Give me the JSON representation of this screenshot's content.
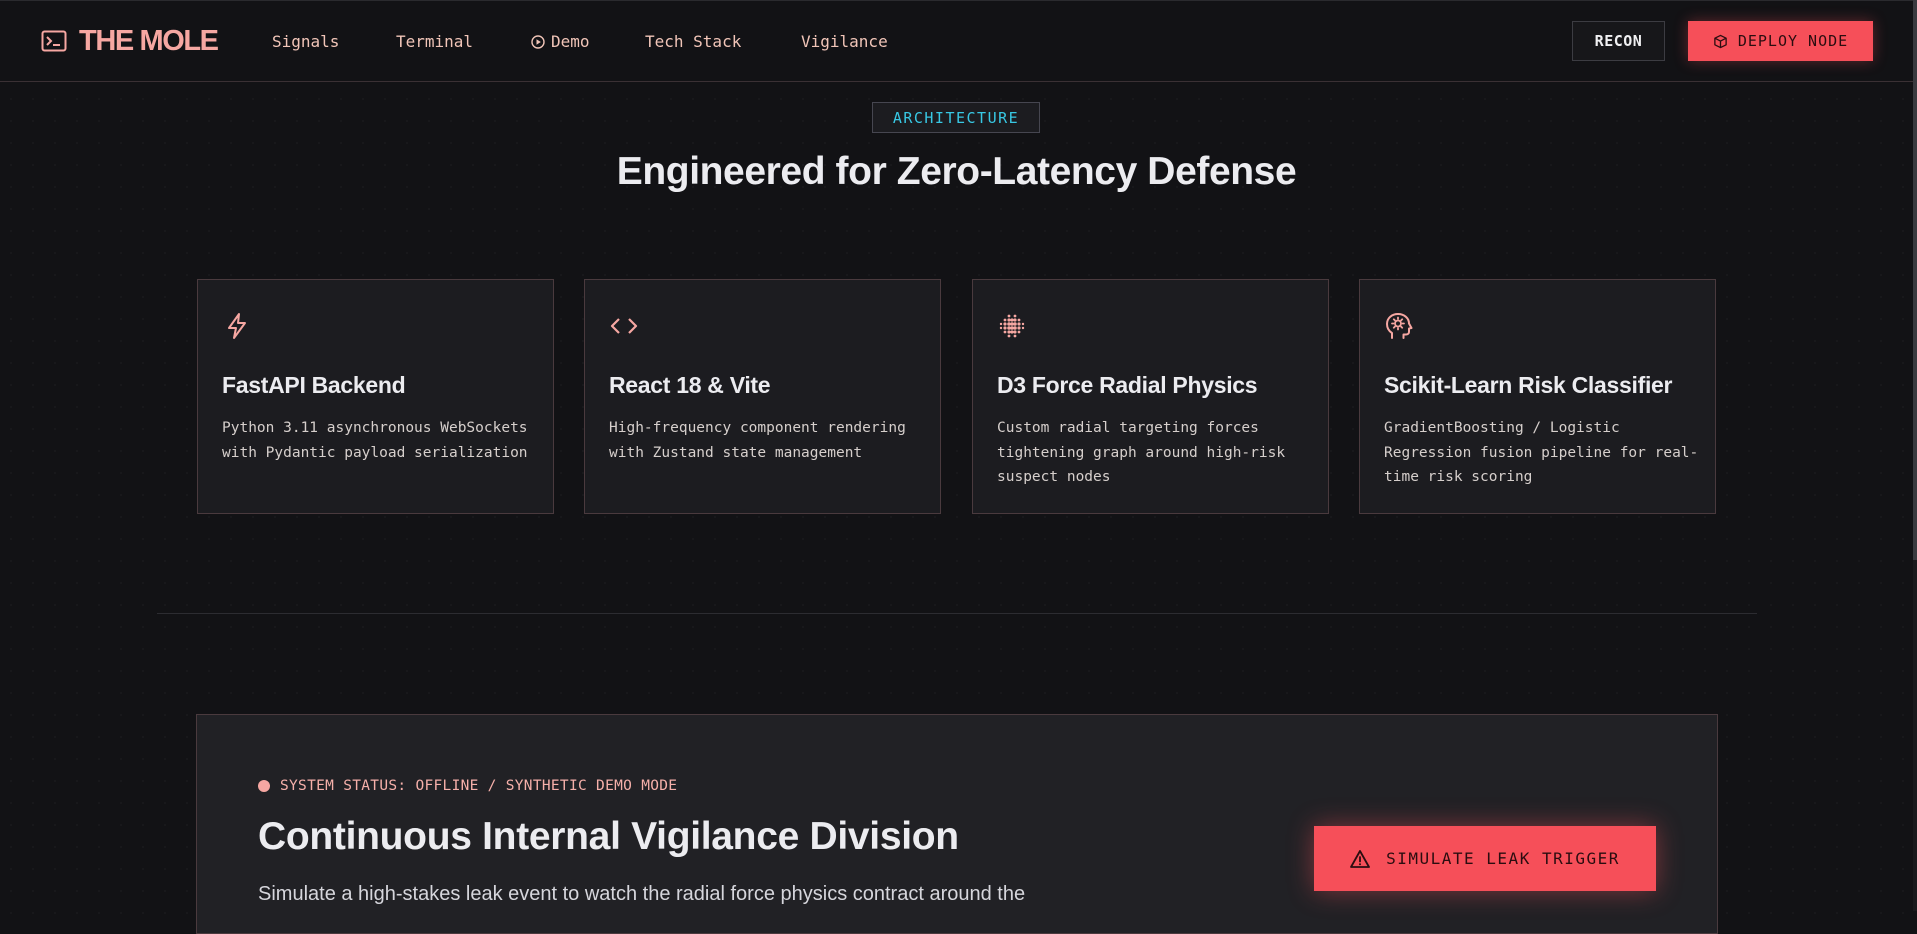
{
  "nav": {
    "brand": "THE MOLE",
    "links": [
      "Signals",
      "Terminal",
      "Demo",
      "Tech Stack",
      "Vigilance"
    ],
    "recon_label": "RECON",
    "deploy_label": "DEPLOY NODE"
  },
  "architecture": {
    "tag": "ARCHITECTURE",
    "heading": "Engineered for Zero-Latency Defense",
    "cards": [
      {
        "icon": "lightning-icon",
        "title": "FastAPI Backend",
        "description": "Python 3.11 asynchronous WebSockets with Pydantic payload serialization"
      },
      {
        "icon": "code-brackets-icon",
        "title": "React 18 & Vite",
        "description": "High-frequency component rendering with Zustand state management"
      },
      {
        "icon": "dot-grid-icon",
        "title": "D3 Force Radial Physics",
        "description": "Custom radial targeting forces tightening graph around high-risk suspect nodes"
      },
      {
        "icon": "brain-gear-icon",
        "title": "Scikit-Learn Risk Classifier",
        "description": "GradientBoosting / Logistic Regression fusion pipeline for real-time risk scoring"
      }
    ]
  },
  "vigilance": {
    "status": "SYSTEM STATUS: OFFLINE / SYNTHETIC DEMO MODE",
    "title": "Continuous Internal Vigilance Division",
    "description": "Simulate a high-stakes leak event to watch the radial force physics contract around the",
    "button_label": "SIMULATE LEAK TRIGGER"
  },
  "colors": {
    "accent": "#f64f59",
    "brand_pink": "#f6a7a2",
    "tag_cyan": "#38c8e4",
    "background": "#121215"
  }
}
